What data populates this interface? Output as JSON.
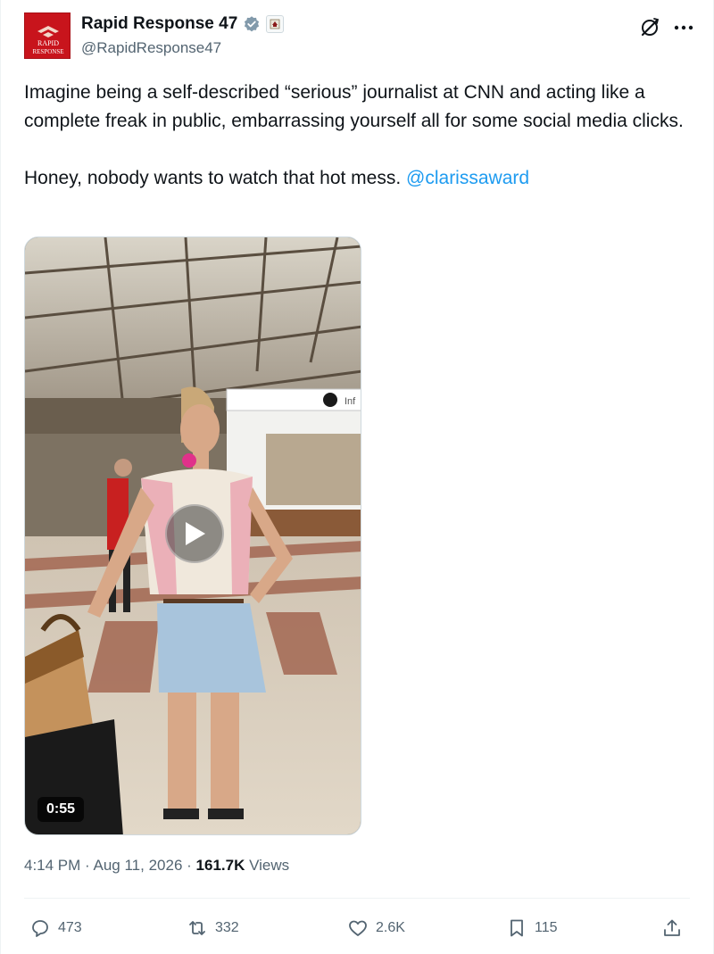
{
  "author": {
    "display_name": "Rapid Response 47",
    "handle": "@RapidResponse47",
    "avatar_text_top": "RAPID",
    "avatar_text_bottom": "RESPONSE"
  },
  "icons": {
    "verified": "verified-badge-icon",
    "affiliation": "affiliation-badge-icon",
    "grok": "grok-icon",
    "more": "more-icon",
    "play": "play-icon",
    "reply": "reply-icon",
    "repost": "repost-icon",
    "like": "like-icon",
    "bookmark": "bookmark-icon",
    "share": "share-icon"
  },
  "tweet": {
    "paragraph_1": "Imagine being a self-described “serious” journalist at CNN and acting like a complete freak in public, embarrassing yourself all for some social media clicks.",
    "paragraph_2_text": "Honey, nobody wants to watch that hot mess.",
    "mention": "@clarissaward"
  },
  "media": {
    "duration": "0:55",
    "sign_text": "Inf"
  },
  "meta": {
    "time": "4:14 PM",
    "separator": "·",
    "date": "Aug 11, 2026",
    "views_count": "161.7K",
    "views_label": "Views"
  },
  "stats": {
    "replies": "473",
    "reposts": "332",
    "likes": "2.6K",
    "bookmarks": "115"
  },
  "colors": {
    "link": "#1d9bf0",
    "secondary_text": "#536471",
    "primary_text": "#0f1419",
    "verified": "#829aab",
    "avatar_bg": "#c8141c"
  }
}
